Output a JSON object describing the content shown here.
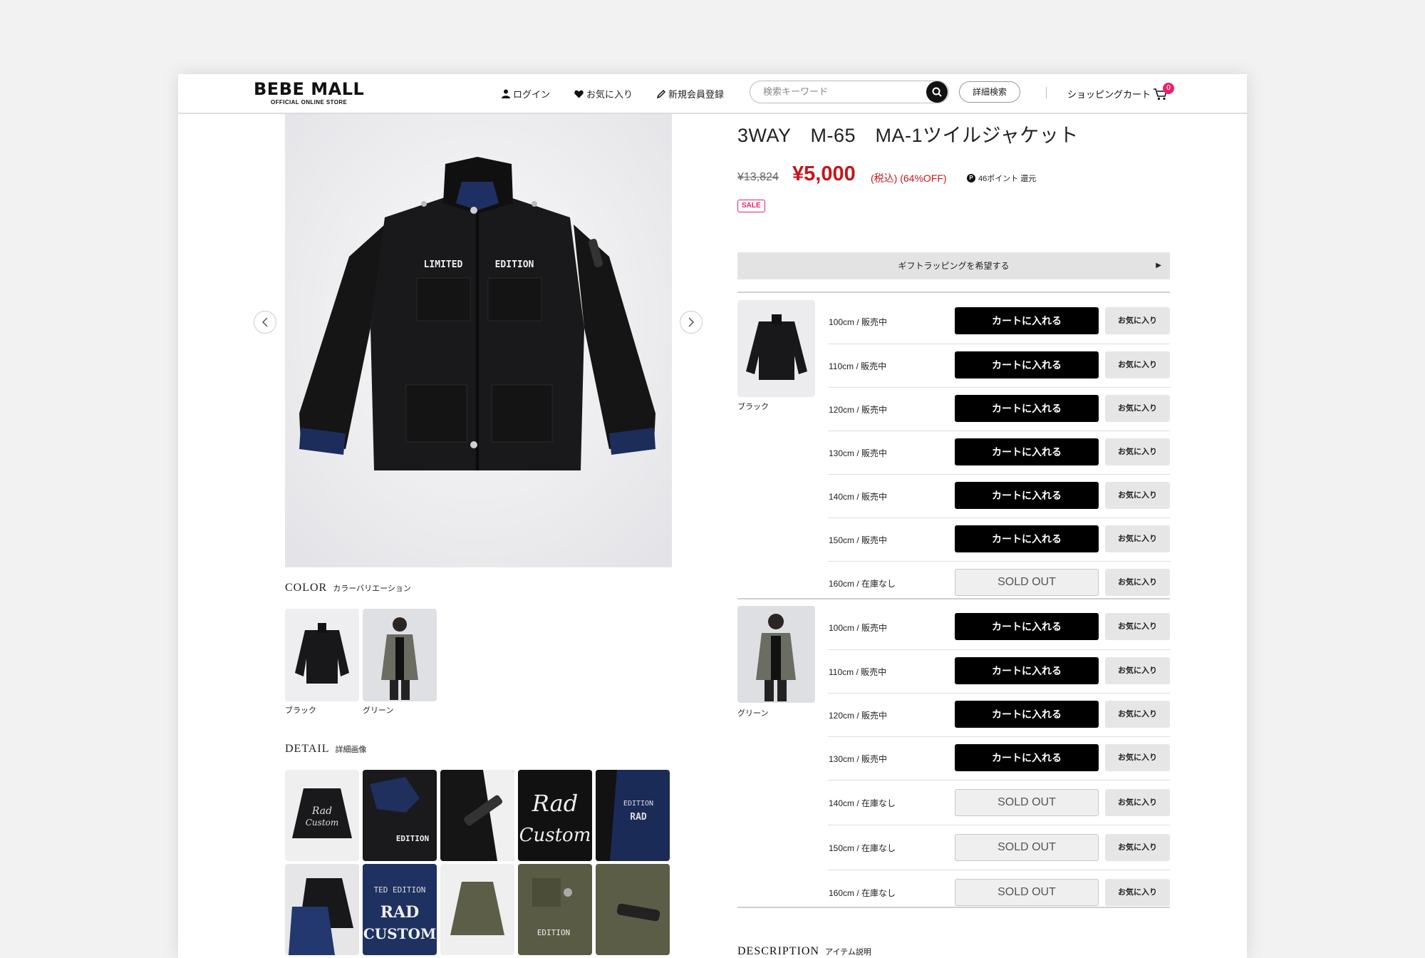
{
  "header": {
    "logo_main": "BEBE MALL",
    "logo_sub": "OFFICIAL ONLINE STORE",
    "nav": [
      {
        "label": "ログイン",
        "icon": "user-icon"
      },
      {
        "label": "お気に入り",
        "icon": "heart-icon"
      },
      {
        "label": "新規会員登録",
        "icon": "pencil-icon"
      }
    ],
    "search_placeholder": "検索キーワード",
    "advanced_search": "詳細検索",
    "cart_label": "ショッピングカート",
    "cart_count": "0"
  },
  "product": {
    "title": "3WAY　M-65　MA-1ツイルジャケット",
    "original_price": "¥13,824",
    "sale_price": "¥5,000",
    "tax_note": "(税込) (64%OFF)",
    "points": "46ポイント 還元",
    "sale_badge": "SALE",
    "gift_wrap": "ギフトラッピングを希望する"
  },
  "colors_section": {
    "title": "COLOR",
    "subtitle": "カラーバリエーション",
    "items": [
      {
        "label": "ブラック"
      },
      {
        "label": "グリーン"
      }
    ]
  },
  "detail_section": {
    "title": "DETAIL",
    "subtitle": "詳細画像"
  },
  "description_section": {
    "title": "DESCRIPTION",
    "subtitle": "アイテム説明"
  },
  "variants": {
    "black": {
      "color_label": "ブラック",
      "rows": [
        {
          "label": "100cm / 販売中",
          "button": "カートに入れる",
          "fav": "お気に入り"
        },
        {
          "label": "110cm / 販売中",
          "button": "カートに入れる",
          "fav": "お気に入り"
        },
        {
          "label": "120cm / 販売中",
          "button": "カートに入れる",
          "fav": "お気に入り"
        },
        {
          "label": "130cm / 販売中",
          "button": "カートに入れる",
          "fav": "お気に入り"
        },
        {
          "label": "140cm / 販売中",
          "button": "カートに入れる",
          "fav": "お気に入り"
        },
        {
          "label": "150cm / 販売中",
          "button": "カートに入れる",
          "fav": "お気に入り"
        },
        {
          "label": "160cm / 在庫なし",
          "button": "SOLD OUT",
          "fav": "お気に入り"
        }
      ]
    },
    "green": {
      "color_label": "グリーン",
      "rows": [
        {
          "label": "100cm / 販売中",
          "button": "カートに入れる",
          "fav": "お気に入り"
        },
        {
          "label": "110cm / 販売中",
          "button": "カートに入れる",
          "fav": "お気に入り"
        },
        {
          "label": "120cm / 販売中",
          "button": "カートに入れる",
          "fav": "お気に入り"
        },
        {
          "label": "130cm / 販売中",
          "button": "カートに入れる",
          "fav": "お気に入り"
        },
        {
          "label": "140cm / 在庫なし",
          "button": "SOLD OUT",
          "fav": "お気に入り"
        },
        {
          "label": "150cm / 在庫なし",
          "button": "SOLD OUT",
          "fav": "お気に入り"
        },
        {
          "label": "160cm / 在庫なし",
          "button": "SOLD OUT",
          "fav": "お気に入り"
        }
      ]
    }
  },
  "colors": {
    "sale_red": "#c4171a",
    "badge_pink": "#e6236e",
    "cart_button": "#000000"
  }
}
